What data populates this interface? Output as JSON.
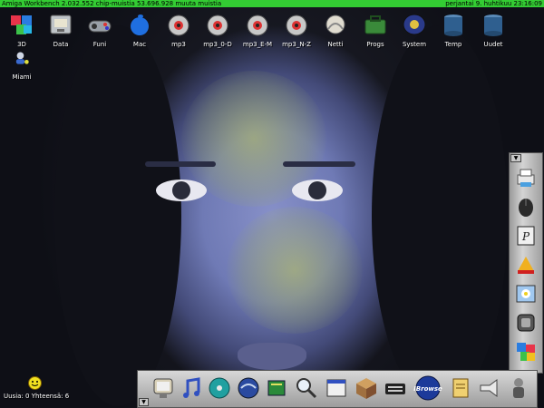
{
  "titlebar": {
    "left_text": "Amiga Workbench  2.032.552 chip-muistia  53.696.928 muuta muistia",
    "right_text": "perjantai 9. huhtikuu  23:16:09"
  },
  "desktop_icons": [
    {
      "label": "3D",
      "icon": "3d-cubes-icon"
    },
    {
      "label": "Data",
      "icon": "data-drawer-icon"
    },
    {
      "label": "Funi",
      "icon": "gamepad-icon"
    },
    {
      "label": "Mac",
      "icon": "apple-icon"
    },
    {
      "label": "mp3",
      "icon": "speaker-disk-icon"
    },
    {
      "label": "mp3_0-D",
      "icon": "speaker-disk-icon"
    },
    {
      "label": "mp3_E-M",
      "icon": "speaker-disk-icon"
    },
    {
      "label": "mp3_N-Z",
      "icon": "speaker-disk-icon"
    },
    {
      "label": "Netti",
      "icon": "globe-hand-icon"
    },
    {
      "label": "Progs",
      "icon": "toolbox-icon"
    },
    {
      "label": "System",
      "icon": "system-drive-icon"
    },
    {
      "label": "Temp",
      "icon": "trash-can-icon"
    },
    {
      "label": "Uudet",
      "icon": "trash-can-icon"
    },
    {
      "label": "Miami",
      "icon": "network-user-icon"
    }
  ],
  "right_dock": {
    "arrow": "▼",
    "items": [
      {
        "icon": "printer-icon"
      },
      {
        "icon": "mouse-icon"
      },
      {
        "icon": "pagestream-icon"
      },
      {
        "icon": "paint-program-icon"
      },
      {
        "icon": "picture-viewer-icon"
      },
      {
        "icon": "shell-icon"
      },
      {
        "icon": "cubes-app-icon"
      }
    ]
  },
  "bottom_dock": {
    "arrow": "▼",
    "items": [
      {
        "icon": "monitor-icon"
      },
      {
        "icon": "music-note-icon"
      },
      {
        "icon": "cd-icon"
      },
      {
        "icon": "ball-icon"
      },
      {
        "icon": "book-icon"
      },
      {
        "icon": "magnifier-icon"
      },
      {
        "icon": "window-icon"
      },
      {
        "icon": "box-icon"
      },
      {
        "icon": "keyboard-icon"
      },
      {
        "icon": "ibrowse-icon",
        "label": "IBrowse"
      },
      {
        "icon": "notepad-icon"
      },
      {
        "icon": "megaphone-icon"
      },
      {
        "icon": "character-icon"
      }
    ]
  },
  "mail_status": {
    "text": "Uusia: 0 Yhteensä: 6",
    "icon": "smiley-icon"
  },
  "colors": {
    "titlebar": "#33cc33",
    "icon_label": "#ffffff"
  }
}
